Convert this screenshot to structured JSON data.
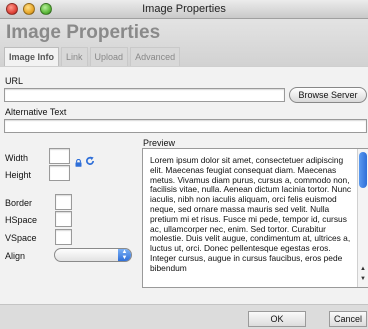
{
  "window": {
    "title": "Image Properties"
  },
  "dialog": {
    "title": "Image Properties",
    "tabs": [
      {
        "label": "Image Info",
        "active": true
      },
      {
        "label": "Link",
        "active": false
      },
      {
        "label": "Upload",
        "active": false
      },
      {
        "label": "Advanced",
        "active": false
      }
    ]
  },
  "form": {
    "url_label": "URL",
    "url_value": "",
    "browse_label": "Browse Server",
    "alt_label": "Alternative Text",
    "alt_value": "",
    "width_label": "Width",
    "height_label": "Height",
    "border_label": "Border",
    "hspace_label": "HSpace",
    "vspace_label": "VSpace",
    "align_label": "Align",
    "align_value": "",
    "preview_label": "Preview"
  },
  "preview": {
    "text": "Lorem ipsum dolor sit amet, consectetuer adipiscing elit. Maecenas feugiat consequat diam. Maecenas metus. Vivamus diam purus, cursus a, commodo non, facilisis vitae, nulla. Aenean dictum lacinia tortor. Nunc iaculis, nibh non iaculis aliquam, orci felis euismod neque, sed ornare massa mauris sed velit. Nulla pretium mi et risus. Fusce mi pede, tempor id, cursus ac, ullamcorper nec, enim. Sed tortor. Curabitur molestie. Duis velit augue, condimentum at, ultrices a, luctus ut, orci. Donec pellentesque egestas eros. Integer cursus, augue in cursus faucibus, eros pede bibendum"
  },
  "footer": {
    "ok_label": "OK",
    "cancel_label": "Cancel"
  },
  "icons": {
    "lock": "lock-icon",
    "reset": "reset-size-icon",
    "accent": "#2f6fd8"
  }
}
